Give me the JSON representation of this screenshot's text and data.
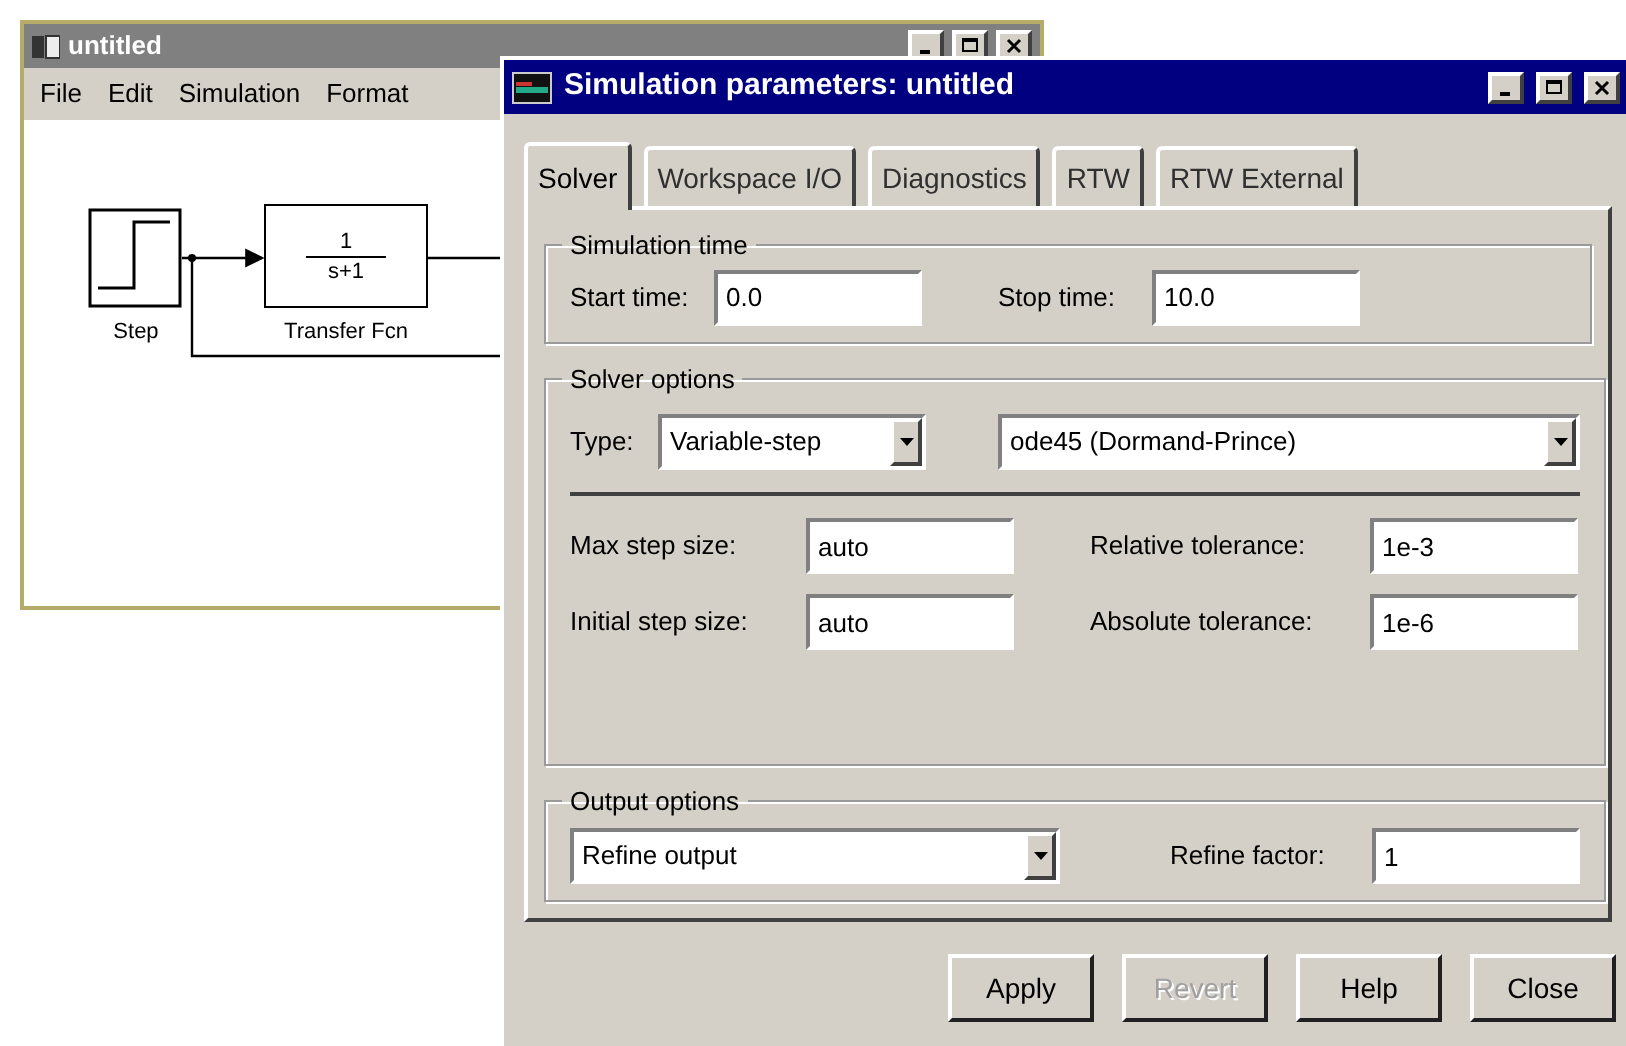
{
  "model_window": {
    "title": "untitled",
    "menu": [
      "File",
      "Edit",
      "Simulation",
      "Format"
    ],
    "blocks": [
      {
        "kind": "step",
        "label": "Step"
      },
      {
        "kind": "transfer_fcn",
        "numerator": "1",
        "denominator": "s+1",
        "label": "Transfer Fcn"
      }
    ]
  },
  "dialog": {
    "title": "Simulation parameters: untitled",
    "tabs": [
      {
        "label": "Solver",
        "selected": true
      },
      {
        "label": "Workspace I/O",
        "selected": false
      },
      {
        "label": "Diagnostics",
        "selected": false
      },
      {
        "label": "RTW",
        "selected": false
      },
      {
        "label": "RTW External",
        "selected": false
      }
    ],
    "simulation_time": {
      "title": "Simulation time",
      "start_label": "Start time:",
      "start_value": "0.0",
      "stop_label": "Stop time:",
      "stop_value": "10.0"
    },
    "solver_options": {
      "title": "Solver options",
      "type_label": "Type:",
      "type_value": "Variable-step",
      "solver_value": "ode45 (Dormand-Prince)",
      "fields": [
        {
          "label": "Max step size:",
          "value": "auto"
        },
        {
          "label": "Relative tolerance:",
          "value": "1e-3"
        },
        {
          "label": "Initial step size:",
          "value": "auto"
        },
        {
          "label": "Absolute tolerance:",
          "value": "1e-6"
        }
      ]
    },
    "output_options": {
      "title": "Output options",
      "mode_value": "Refine output",
      "factor_label": "Refine factor:",
      "factor_value": "1"
    },
    "buttons": [
      {
        "label": "Apply",
        "disabled": false
      },
      {
        "label": "Revert",
        "disabled": true
      },
      {
        "label": "Help",
        "disabled": false
      },
      {
        "label": "Close",
        "disabled": false
      }
    ]
  }
}
